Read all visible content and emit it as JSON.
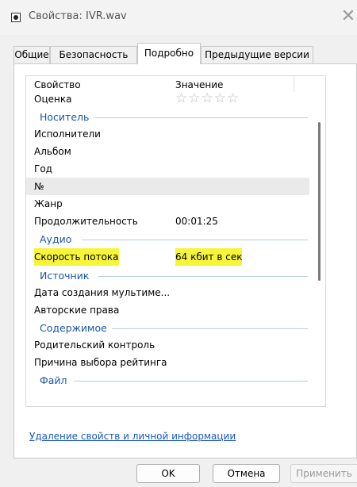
{
  "window": {
    "title": "Свойства: IVR.wav",
    "close_glyph": "✕"
  },
  "tabs": [
    {
      "label": "Общие"
    },
    {
      "label": "Безопасность"
    },
    {
      "label": "Подробно",
      "active": true
    },
    {
      "label": "Предыдущие версии"
    }
  ],
  "columns": {
    "property": "Свойство",
    "value": "Значение"
  },
  "rating": {
    "label": "Оценка",
    "stars": "☆☆☆☆☆",
    "value": 0,
    "max": 5
  },
  "groups": {
    "media": "Носитель",
    "audio": "Аудио",
    "source": "Источник",
    "content": "Содержимое",
    "file": "Файл"
  },
  "media_rows": [
    {
      "key": "Исполнители",
      "value": ""
    },
    {
      "key": "Альбом",
      "value": ""
    },
    {
      "key": "Год",
      "value": ""
    },
    {
      "key": "№",
      "value": ""
    },
    {
      "key": "Жанр",
      "value": ""
    },
    {
      "key": "Продолжительность",
      "value": "00:01:25"
    }
  ],
  "audio_rows": [
    {
      "key": "Скорость потока",
      "value": "64 кбит в сек"
    }
  ],
  "source_rows": [
    {
      "key": "Дата создания мультиме...",
      "value": ""
    },
    {
      "key": "Авторские права",
      "value": ""
    }
  ],
  "content_rows": [
    {
      "key": "Родительский контроль",
      "value": ""
    },
    {
      "key": "Причина выбора рейтинга",
      "value": ""
    }
  ],
  "remove_link": "Удаление свойств и личной информации",
  "buttons": {
    "ok": "OK",
    "cancel": "Отмена",
    "apply": "Применить"
  },
  "colors": {
    "group_label": "#1a56a8",
    "highlight": "#f7f53a",
    "link": "#1a57c4"
  }
}
